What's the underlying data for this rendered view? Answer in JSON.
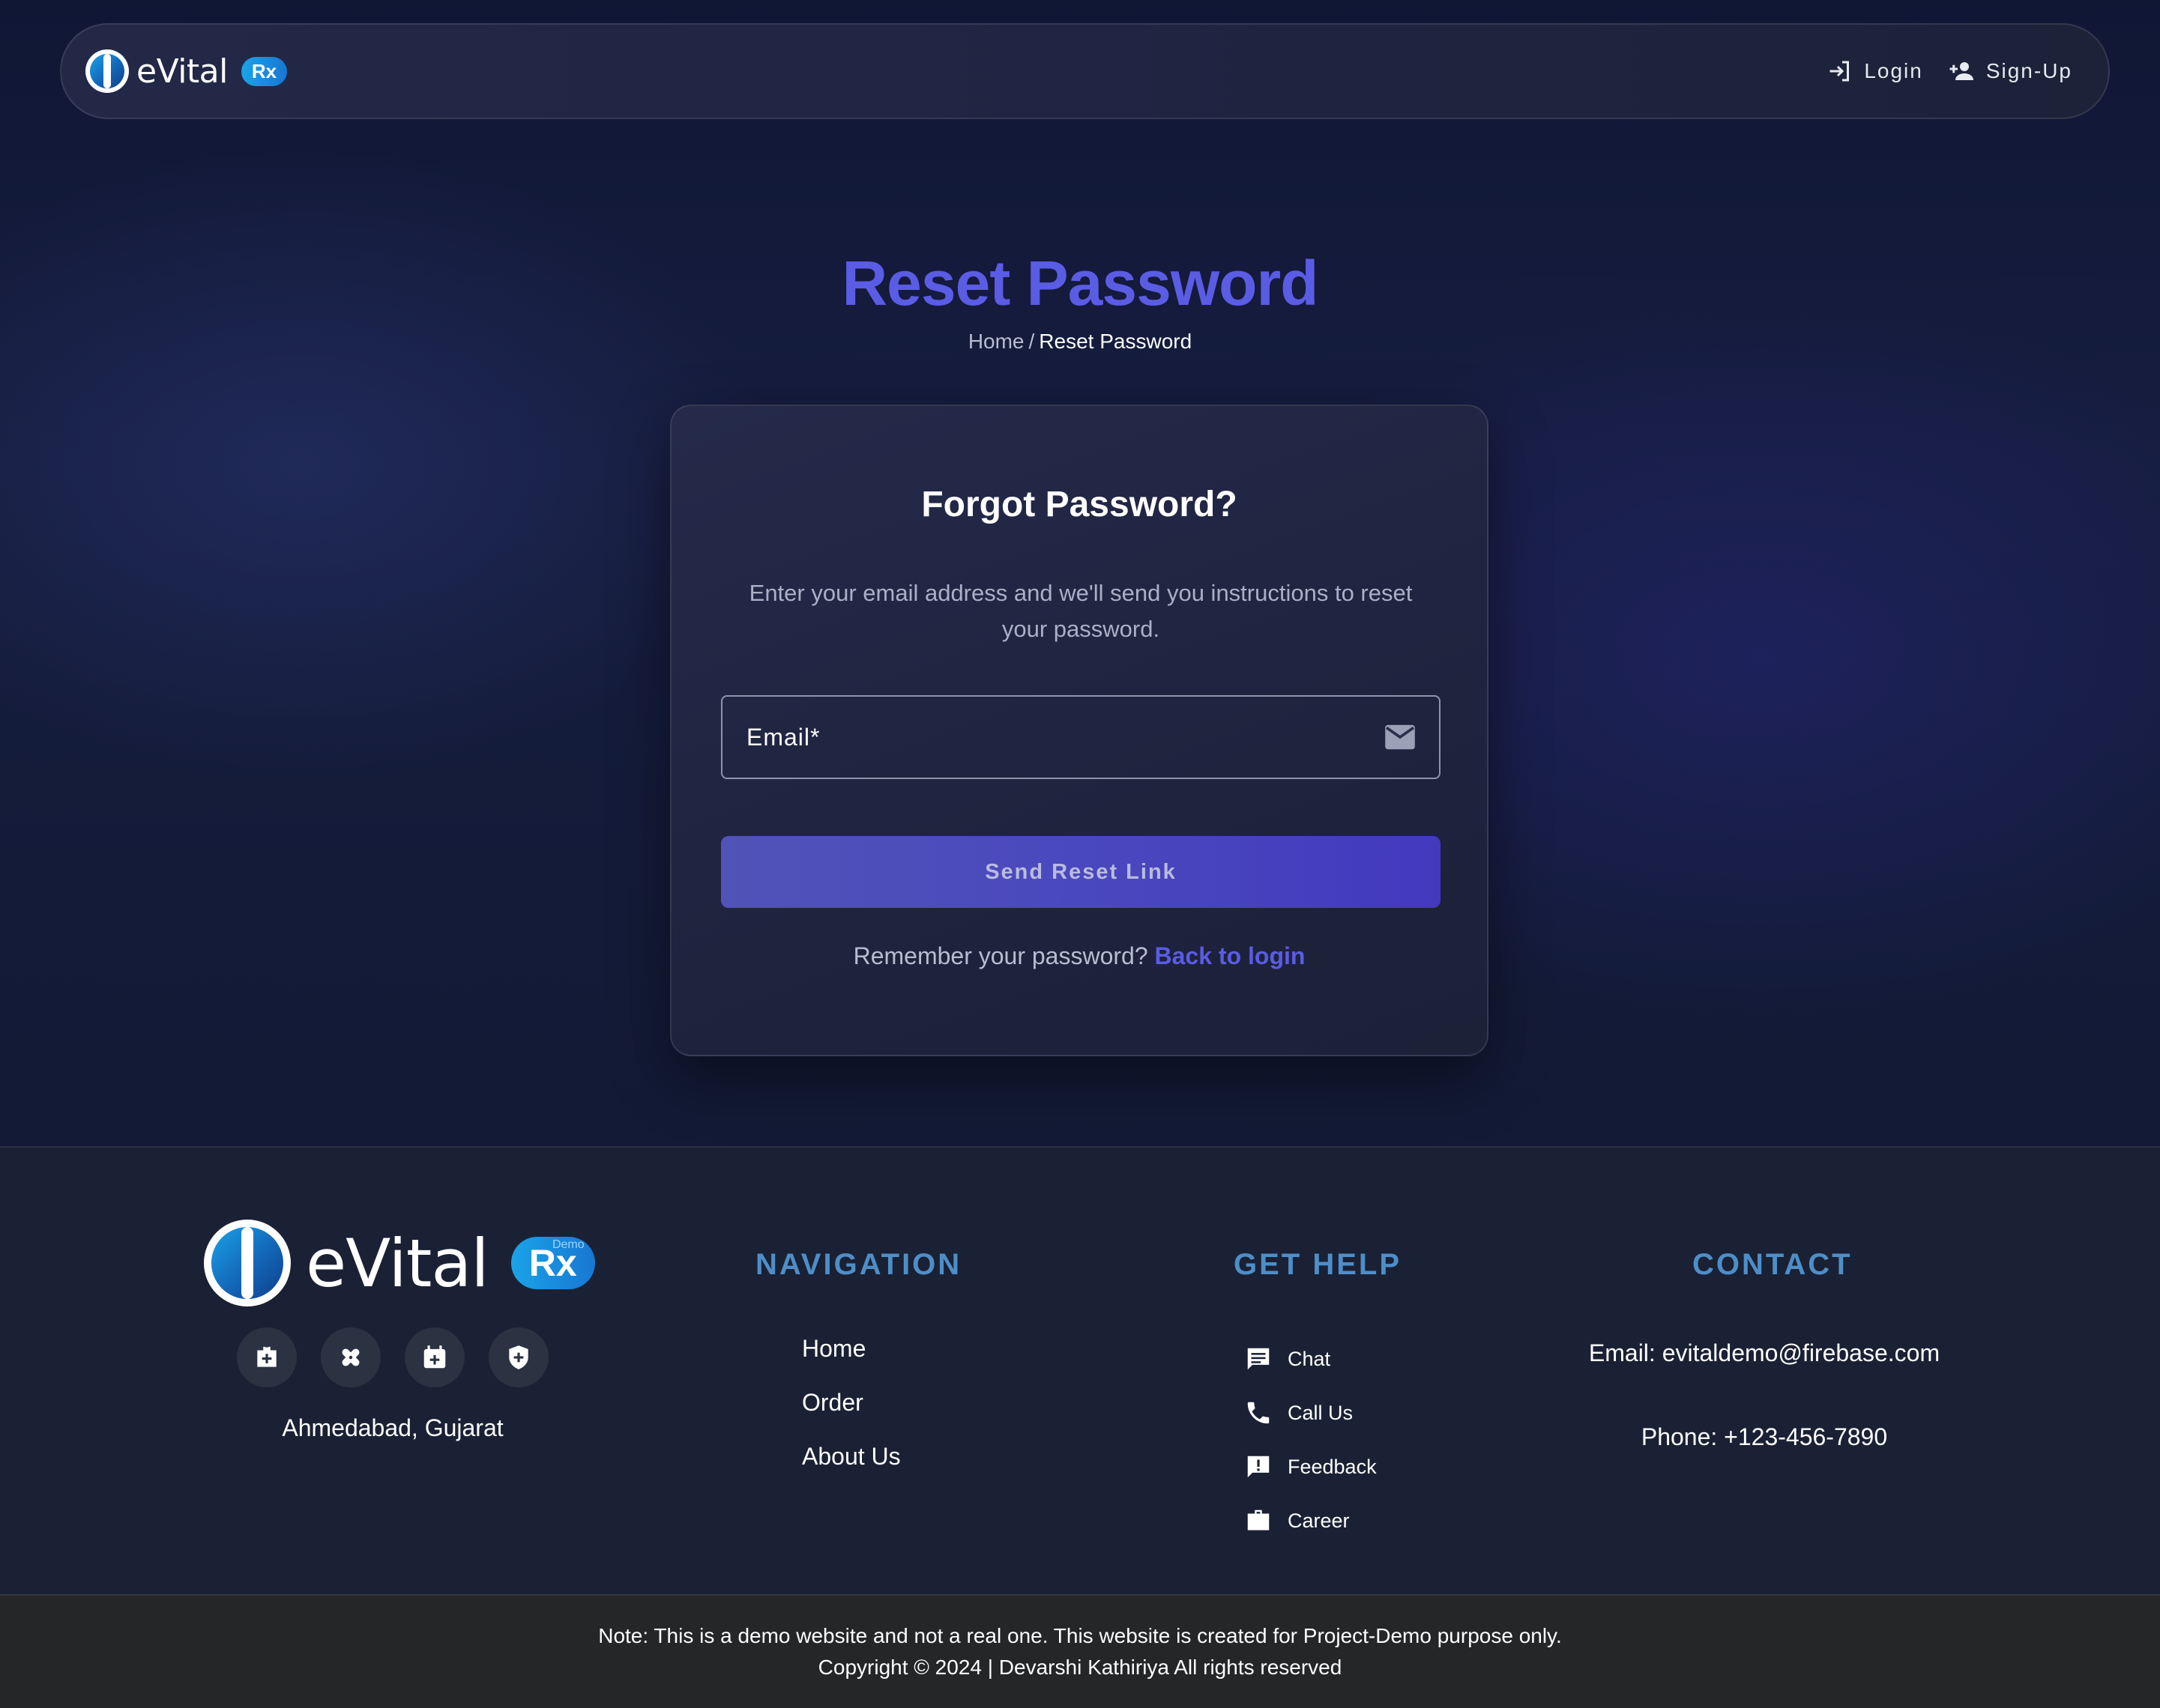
{
  "navbar": {
    "brand": "eVital",
    "badge": "Rx",
    "login": "Login",
    "signup": "Sign-Up"
  },
  "header": {
    "title": "Reset Password",
    "breadcrumb_home": "Home",
    "breadcrumb_sep": "/",
    "breadcrumb_current": "Reset Password"
  },
  "form": {
    "title": "Forgot Password?",
    "description": "Enter your email address and we'll send you instructions to reset your password.",
    "email_label": "Email*",
    "submit": "Send Reset Link",
    "remember_text": "Remember your password?",
    "back_link": "Back to login"
  },
  "footer": {
    "brand": "eVital",
    "badge": "Rx",
    "badge_tag": "Demo",
    "social_icons": [
      "medical-bag-icon",
      "bandage-icon",
      "calendar-plus-icon",
      "shield-plus-icon"
    ],
    "location": "Ahmedabad, Gujarat",
    "navigation": {
      "heading": "NAVIGATION",
      "items": [
        "Home",
        "Order",
        "About Us"
      ]
    },
    "help": {
      "heading": "GET HELP",
      "items": [
        {
          "label": "Chat",
          "icon": "chat-icon"
        },
        {
          "label": "Call Us",
          "icon": "phone-icon"
        },
        {
          "label": "Feedback",
          "icon": "feedback-icon"
        },
        {
          "label": "Career",
          "icon": "briefcase-icon"
        }
      ]
    },
    "contact": {
      "heading": "CONTACT",
      "email": "Email: evitaldemo@firebase.com",
      "phone": "Phone: +123-456-7890"
    },
    "note": "Note: This is a demo website and not a real one. This website is created for Project-Demo purpose only.",
    "copyright": "Copyright © 2024 | Devarshi Kathiriya All rights reserved"
  },
  "colors": {
    "accent": "#5a5ce4",
    "heading_blue": "#4e8ec8",
    "button": "#4a48be",
    "background": "#0f1529",
    "footer": "#1a2134"
  }
}
